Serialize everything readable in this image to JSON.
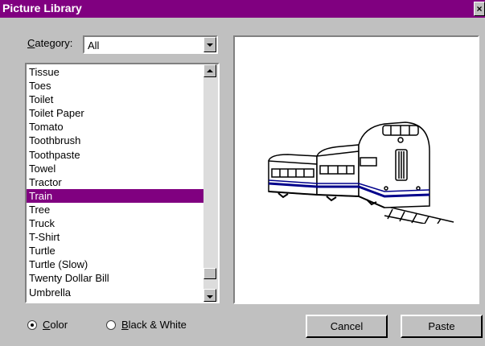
{
  "window": {
    "title": "Picture Library",
    "close_glyph": "×"
  },
  "category": {
    "label": "Category:",
    "selected": "All"
  },
  "list": {
    "items": [
      "Tissue",
      "Toes",
      "Toilet",
      "Toilet Paper",
      "Tomato",
      "Toothbrush",
      "Toothpaste",
      "Towel",
      "Tractor",
      "Train",
      "Tree",
      "Truck",
      "T-Shirt",
      "Turtle",
      "Turtle (Slow)",
      "Twenty Dollar Bill",
      "Umbrella"
    ],
    "selected": "Train"
  },
  "preview": {
    "image": "train-image",
    "colors": {
      "stripe": "#00008b",
      "outline": "#000000"
    }
  },
  "options": {
    "color_label": "Color",
    "bw_label": "Black & White",
    "selected": "Color"
  },
  "buttons": {
    "cancel": "Cancel",
    "paste": "Paste"
  },
  "colors": {
    "accent": "#800080",
    "face": "#c0c0c0"
  }
}
